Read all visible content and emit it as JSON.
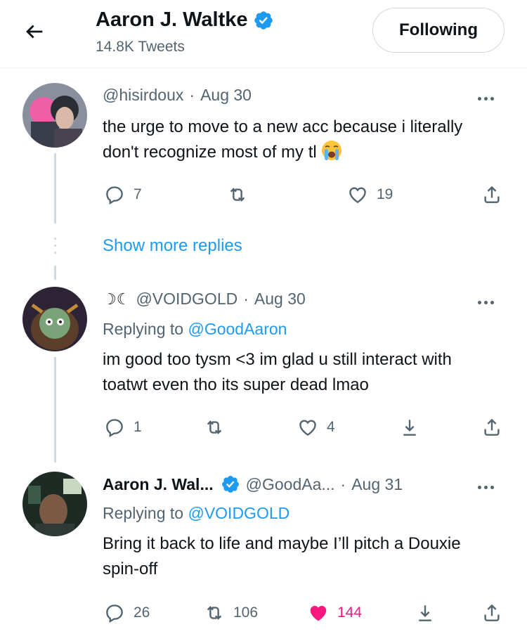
{
  "header": {
    "title": "Aaron J. Waltke",
    "subtitle": "14.8K Tweets",
    "follow_label": "Following"
  },
  "tweets": [
    {
      "handle": "@hisirdoux",
      "sep": "·",
      "date": "Aug 30",
      "text": "the urge to move to a new acc because i literally don't recognize most of my tl",
      "emoji": "loudly-crying-face-icon",
      "replies": "7",
      "retweets": "",
      "likes": "19"
    },
    {
      "display_prefix": "☽☾",
      "handle": "@VOIDGOLD",
      "sep": "·",
      "date": "Aug 30",
      "replying_prefix": "Replying to",
      "replying_to": "@GoodAaron",
      "text": "im good too tysm <3 im glad u still interact with toatwt even tho its super dead lmao",
      "replies": "1",
      "retweets": "",
      "likes": "4"
    },
    {
      "display_name": "Aaron J. Wal...",
      "handle": "@GoodAa...",
      "sep": "·",
      "date": "Aug 31",
      "replying_prefix": "Replying to",
      "replying_to": "@VOIDGOLD",
      "text": "Bring it back to life and maybe I’ll pitch a Douxie spin-off",
      "replies": "26",
      "retweets": "106",
      "likes": "144",
      "liked": true
    }
  ],
  "show_more_replies": "Show more replies",
  "colors": {
    "accent": "#1d9bf0",
    "like": "#f91880",
    "muted": "#536471",
    "text": "#0f1419",
    "line": "#cfd9de"
  }
}
